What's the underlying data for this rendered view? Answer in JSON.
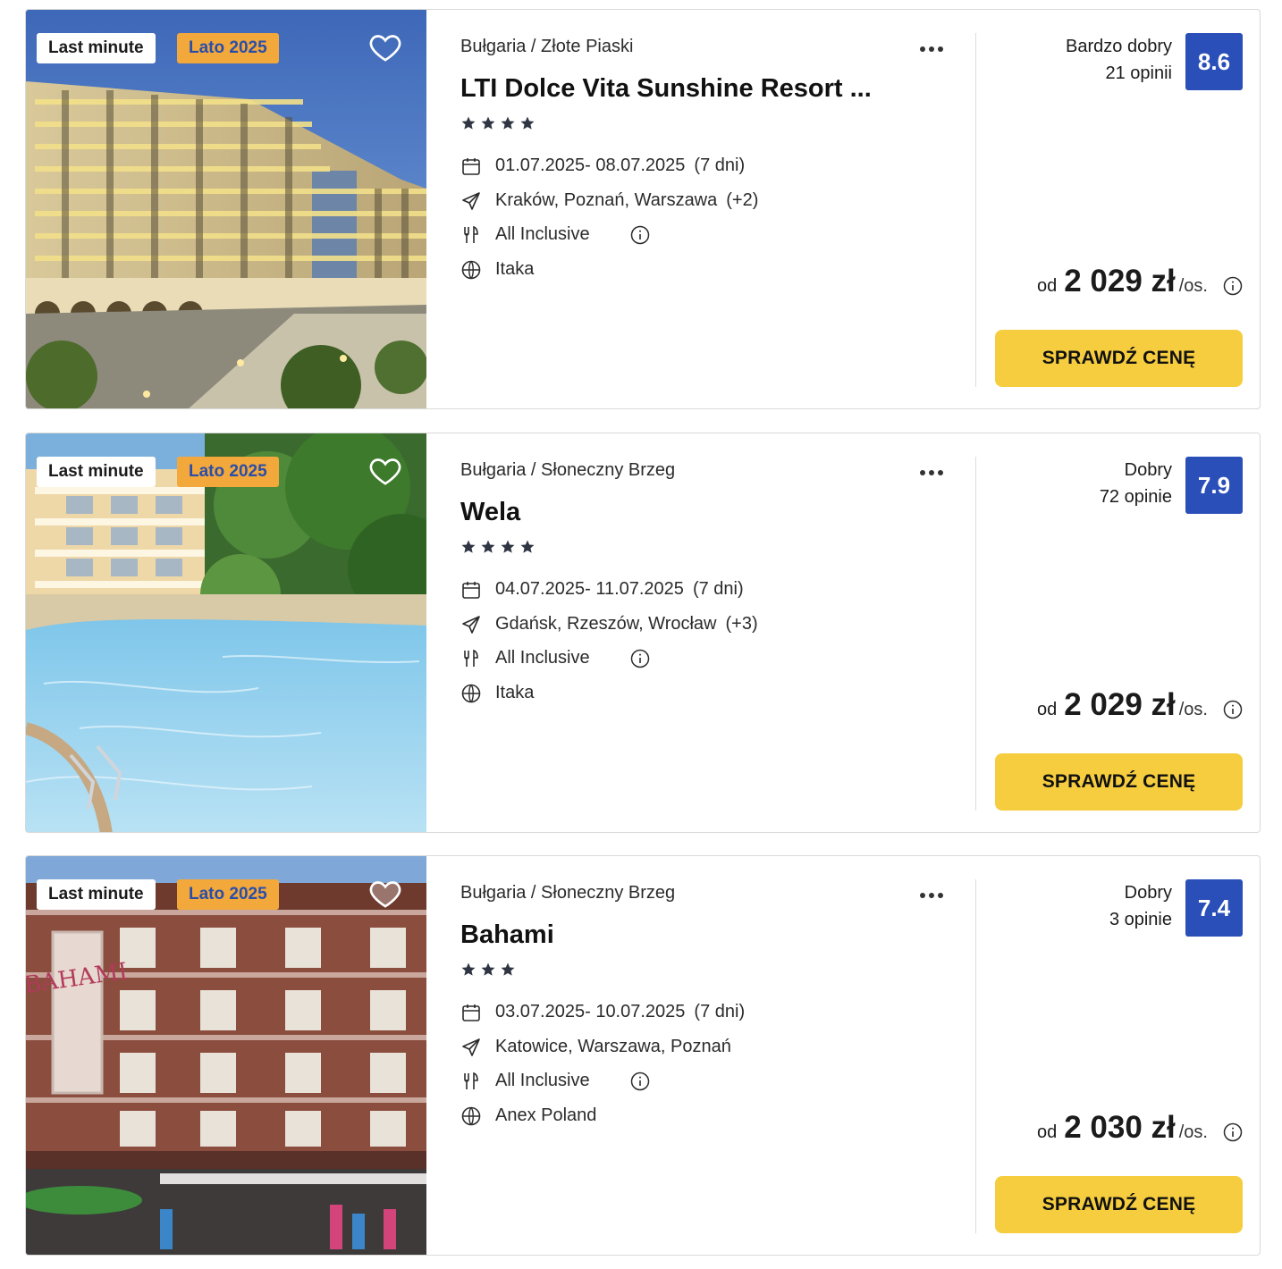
{
  "offers": [
    {
      "badges": {
        "last_minute": "Last minute",
        "season": "Lato 2025"
      },
      "location": "Bułgaria / Złote Piaski",
      "name": "LTI Dolce Vita Sunshine Resort ...",
      "stars": 4,
      "dates": "01.07.2025- 08.07.2025",
      "duration": "(7 dni)",
      "departures": "Kraków, Poznań, Warszawa",
      "departures_extra": "(+2)",
      "board": "All Inclusive",
      "operator": "Itaka",
      "rating_label": "Bardzo dobry",
      "reviews": "21 opinii",
      "score": "8.6",
      "price_prefix": "od",
      "price": "2 029 zł",
      "price_unit": "/os.",
      "cta": "SPRAWDŹ CENĘ"
    },
    {
      "badges": {
        "last_minute": "Last minute",
        "season": "Lato 2025"
      },
      "location": "Bułgaria / Słoneczny Brzeg",
      "name": "Wela",
      "stars": 4,
      "dates": "04.07.2025- 11.07.2025",
      "duration": "(7 dni)",
      "departures": "Gdańsk, Rzeszów, Wrocław",
      "departures_extra": "(+3)",
      "board": "All Inclusive",
      "operator": "Itaka",
      "rating_label": "Dobry",
      "reviews": "72 opinie",
      "score": "7.9",
      "price_prefix": "od",
      "price": "2 029 zł",
      "price_unit": "/os.",
      "cta": "SPRAWDŹ CENĘ"
    },
    {
      "badges": {
        "last_minute": "Last minute",
        "season": "Lato 2025"
      },
      "location": "Bułgaria / Słoneczny Brzeg",
      "name": "Bahami",
      "stars": 3,
      "dates": "03.07.2025- 10.07.2025",
      "duration": "(7 dni)",
      "departures": "Katowice, Warszawa, Poznań",
      "departures_extra": "",
      "board": "All Inclusive",
      "operator": "Anex Poland",
      "rating_label": "Dobry",
      "reviews": "3 opinie",
      "score": "7.4",
      "price_prefix": "od",
      "price": "2 030 zł",
      "price_unit": "/os.",
      "cta": "SPRAWDŹ CENĘ"
    }
  ],
  "hotel_signage": "BAHAMI",
  "colors": {
    "score_bg": "#2a4fb8",
    "cta_bg": "#f6cd3e",
    "season_badge_bg": "#f3a83b",
    "season_badge_text": "#2a4ea8",
    "star": "#2f3542"
  },
  "icons": {
    "favorite": "heart-outline-icon",
    "more": "more-horizontal-icon",
    "dates": "calendar-icon",
    "departures": "airplane-icon",
    "board": "cutlery-icon",
    "operator": "globe-icon",
    "info": "info-circle-icon"
  }
}
